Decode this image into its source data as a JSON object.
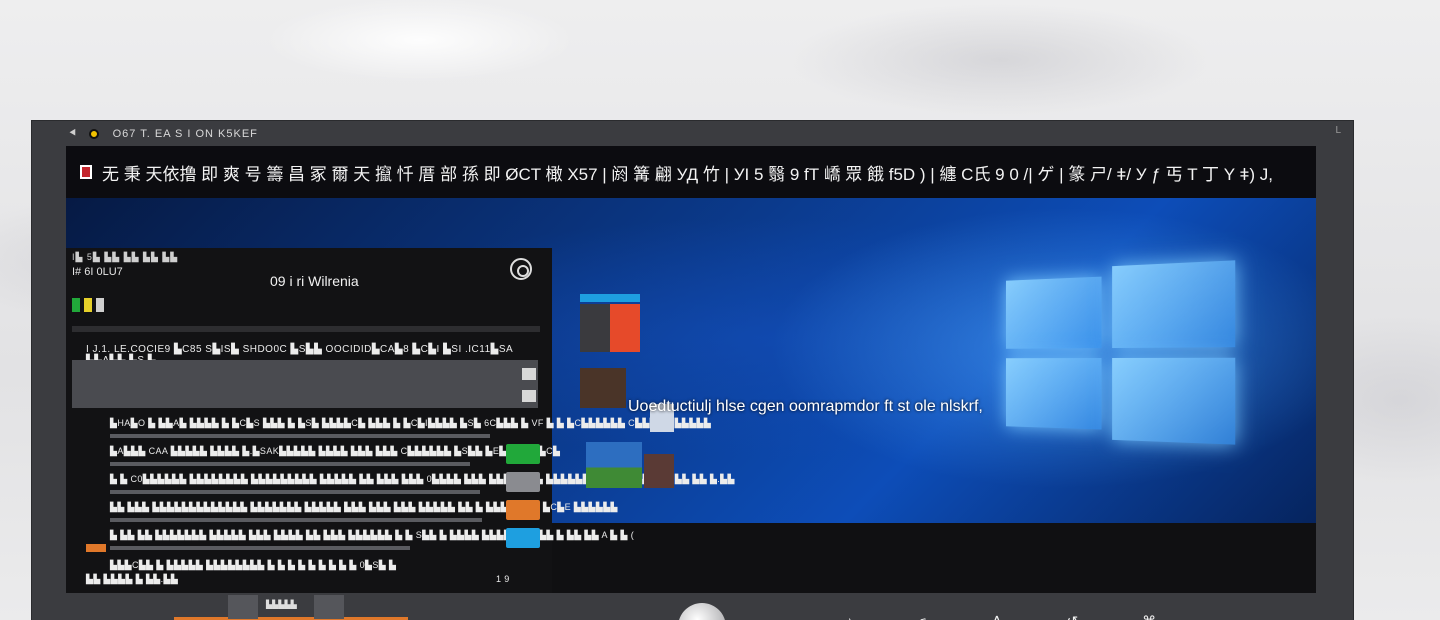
{
  "window": {
    "title": "O67 T. EA S I ON K5KEF",
    "headline": "无 秉 天依撸 即   爽 号 籌 昌    冢 爾 天 攛 忏 厝 部 孫 即    ØCT   橄 X57   |  阏 篝  翩 УД 竹   | УI 5 翳 9 fT 嶠 眾  餓 f5D )   | 纏 С氏 9 0 /|  ゲ   | 篆 ㄕ/ ǂ/ У ƒ 丐 T 丁 Y ǂ) J,"
  },
  "panel": {
    "meta_line": "I▙ 5▙ ▙▙ ▙▙ ▙▙ ▙▙",
    "subtitle": "I# 6I 0LU7",
    "title": "09 i ri Wilrenia",
    "header_row": "I J.1. LE.COCIE9 ▙C85 S▙IS▙ SHDO0C ▙S▙▙ OOCIDID▙CA▙8 ▙C▙I ▙SI .IC11▙SA ▙▙A▙▙  ▙S ▙",
    "rows": [
      {
        "text": "▙HA▙O ▙ ▙▙A▙ ▙▙▙▙ ▙ ▙C▙S ▙▙▙ ▙ ▙S▙ ▙▙▙▙C▙ ▙▙▙ ▙ ▙C▙I▙▙▙▙ ▙S▙ 6C▙▙▙ ▙ VF ▙ ▙ ▙C▙▙▙▙▙▙ C▙▙▙▙▙ ▙▙▙▙▙"
      },
      {
        "text": "▙A▙▙▙ CAA ▙▙▙▙▙ ▙▙▙▙ ▙.▙SAK▙▙▙▙▙ ▙▙▙▙ ▙▙▙ ▙▙▙ C▙▙▙▙▙▙ ▙S▙▙ ▙E▙ ▙▙▙▙▙C▙"
      },
      {
        "text": "▙ ▙ C0▙▙▙▙▙▙ ▙▙▙▙▙▙▙▙ ▙▙▙▙▙▙▙▙▙ ▙▙▙▙▙ ▙▙ ▙▙▙ ▙▙▙ 0▙▙▙▙ ▙▙▙ ▙▙▙▙▙▙ ▙ ▙▙▙▙▙▙▙▙ ▙ ▙ ▙▙▙▙▙▙ ▙▙ ▙▙ ▙.▙▙"
      },
      {
        "text": "▙▙ ▙▙▙ ▙▙▙▙▙▙▙▙▙▙▙▙▙ ▙▙▙▙▙▙▙ ▙▙▙▙▙ ▙▙▙ ▙▙▙ ▙▙▙ ▙▙▙▙▙ ▙▙ ▙ ▙▙▙▙ ▙▙▙ ▙C▙E ▙▙▙▙▙▙"
      },
      {
        "text": "▙ ▙▙ ▙▙ ▙▙▙▙▙▙▙ ▙▙▙▙▙ ▙▙▙ ▙▙▙▙ ▙▙ ▙▙▙ ▙▙▙▙▙▙ ▙ ▙ S▙▙ ▙ ▙▙▙▙ ▙▙▙▙ ▙ ▙▙▙▙ ▙ ▙▙ ▙▙ A ▙ ▙ ("
      },
      {
        "text": "▙▙▙C▙▙ ▙ ▙▙▙▙▙ ▙▙▙▙▙▙▙▙ ▙ ▙ ▙ ▙ ▙ ▙ ▙ ▙ ▙ 0▙S▙ ▙"
      }
    ],
    "footer_left": "▙▙ ▙▙▙▙ ▙ ▙▙.▙▙",
    "footer_right": "1  9"
  },
  "overlay": {
    "caption": "Uoedtuctiulj hlse cgen oomrapmdor ft st ole nlskrf,"
  },
  "dock": {
    "label": "▙▙▙▙▙"
  },
  "colors": {
    "accent_orange": "#e0782a",
    "accent_green": "#21a83a",
    "accent_blue": "#1e9fe0",
    "win_blue": "#0d4db8"
  }
}
